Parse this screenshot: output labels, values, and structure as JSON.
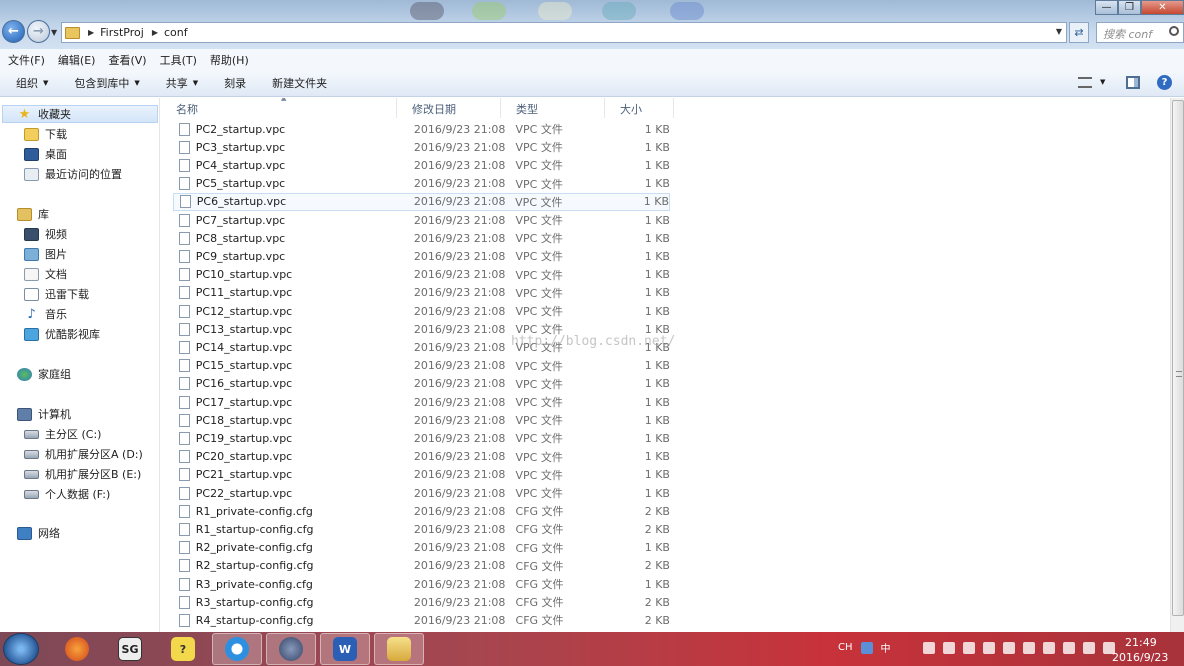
{
  "address": {
    "crumbs": [
      "FirstProj",
      "conf"
    ],
    "search_placeholder": "搜索 conf"
  },
  "menu": [
    "文件(F)",
    "编辑(E)",
    "查看(V)",
    "工具(T)",
    "帮助(H)"
  ],
  "toolbar": {
    "organize": "组织",
    "include_library": "包含到库中",
    "share": "共享",
    "burn": "刻录",
    "new_folder": "新建文件夹"
  },
  "nav": {
    "favorites": "收藏夹",
    "downloads": "下载",
    "desktop": "桌面",
    "recent": "最近访问的位置",
    "libraries": "库",
    "videos": "视频",
    "pictures": "图片",
    "documents": "文档",
    "thunder": "迅雷下载",
    "music": "音乐",
    "youku": "优酷影视库",
    "homegroup": "家庭组",
    "computer": "计算机",
    "drive_c": "主分区 (C:)",
    "drive_d": "机用扩展分区A (D:)",
    "drive_e": "机用扩展分区B (E:)",
    "drive_f": "个人数据 (F:)",
    "network": "网络"
  },
  "columns": {
    "name": "名称",
    "date": "修改日期",
    "type": "类型",
    "size": "大小"
  },
  "files": [
    {
      "name": "PC2_startup.vpc",
      "date": "2016/9/23 21:08",
      "type": "VPC 文件",
      "size": "1 KB"
    },
    {
      "name": "PC3_startup.vpc",
      "date": "2016/9/23 21:08",
      "type": "VPC 文件",
      "size": "1 KB"
    },
    {
      "name": "PC4_startup.vpc",
      "date": "2016/9/23 21:08",
      "type": "VPC 文件",
      "size": "1 KB"
    },
    {
      "name": "PC5_startup.vpc",
      "date": "2016/9/23 21:08",
      "type": "VPC 文件",
      "size": "1 KB"
    },
    {
      "name": "PC6_startup.vpc",
      "date": "2016/9/23 21:08",
      "type": "VPC 文件",
      "size": "1 KB"
    },
    {
      "name": "PC7_startup.vpc",
      "date": "2016/9/23 21:08",
      "type": "VPC 文件",
      "size": "1 KB"
    },
    {
      "name": "PC8_startup.vpc",
      "date": "2016/9/23 21:08",
      "type": "VPC 文件",
      "size": "1 KB"
    },
    {
      "name": "PC9_startup.vpc",
      "date": "2016/9/23 21:08",
      "type": "VPC 文件",
      "size": "1 KB"
    },
    {
      "name": "PC10_startup.vpc",
      "date": "2016/9/23 21:08",
      "type": "VPC 文件",
      "size": "1 KB"
    },
    {
      "name": "PC11_startup.vpc",
      "date": "2016/9/23 21:08",
      "type": "VPC 文件",
      "size": "1 KB"
    },
    {
      "name": "PC12_startup.vpc",
      "date": "2016/9/23 21:08",
      "type": "VPC 文件",
      "size": "1 KB"
    },
    {
      "name": "PC13_startup.vpc",
      "date": "2016/9/23 21:08",
      "type": "VPC 文件",
      "size": "1 KB"
    },
    {
      "name": "PC14_startup.vpc",
      "date": "2016/9/23 21:08",
      "type": "VPC 文件",
      "size": "1 KB"
    },
    {
      "name": "PC15_startup.vpc",
      "date": "2016/9/23 21:08",
      "type": "VPC 文件",
      "size": "1 KB"
    },
    {
      "name": "PC16_startup.vpc",
      "date": "2016/9/23 21:08",
      "type": "VPC 文件",
      "size": "1 KB"
    },
    {
      "name": "PC17_startup.vpc",
      "date": "2016/9/23 21:08",
      "type": "VPC 文件",
      "size": "1 KB"
    },
    {
      "name": "PC18_startup.vpc",
      "date": "2016/9/23 21:08",
      "type": "VPC 文件",
      "size": "1 KB"
    },
    {
      "name": "PC19_startup.vpc",
      "date": "2016/9/23 21:08",
      "type": "VPC 文件",
      "size": "1 KB"
    },
    {
      "name": "PC20_startup.vpc",
      "date": "2016/9/23 21:08",
      "type": "VPC 文件",
      "size": "1 KB"
    },
    {
      "name": "PC21_startup.vpc",
      "date": "2016/9/23 21:08",
      "type": "VPC 文件",
      "size": "1 KB"
    },
    {
      "name": "PC22_startup.vpc",
      "date": "2016/9/23 21:08",
      "type": "VPC 文件",
      "size": "1 KB"
    },
    {
      "name": "R1_private-config.cfg",
      "date": "2016/9/23 21:08",
      "type": "CFG 文件",
      "size": "2 KB"
    },
    {
      "name": "R1_startup-config.cfg",
      "date": "2016/9/23 21:08",
      "type": "CFG 文件",
      "size": "2 KB"
    },
    {
      "name": "R2_private-config.cfg",
      "date": "2016/9/23 21:08",
      "type": "CFG 文件",
      "size": "1 KB"
    },
    {
      "name": "R2_startup-config.cfg",
      "date": "2016/9/23 21:08",
      "type": "CFG 文件",
      "size": "2 KB"
    },
    {
      "name": "R3_private-config.cfg",
      "date": "2016/9/23 21:08",
      "type": "CFG 文件",
      "size": "1 KB"
    },
    {
      "name": "R3_startup-config.cfg",
      "date": "2016/9/23 21:08",
      "type": "CFG 文件",
      "size": "2 KB"
    },
    {
      "name": "R4_startup-config.cfg",
      "date": "2016/9/23 21:08",
      "type": "CFG 文件",
      "size": "2 KB"
    }
  ],
  "watermark": "http://blog.csdn.net/",
  "taskbar": {
    "tray_ime": "CH",
    "tray_lang": "中",
    "time": "21:49",
    "date": "2016/9/23"
  }
}
